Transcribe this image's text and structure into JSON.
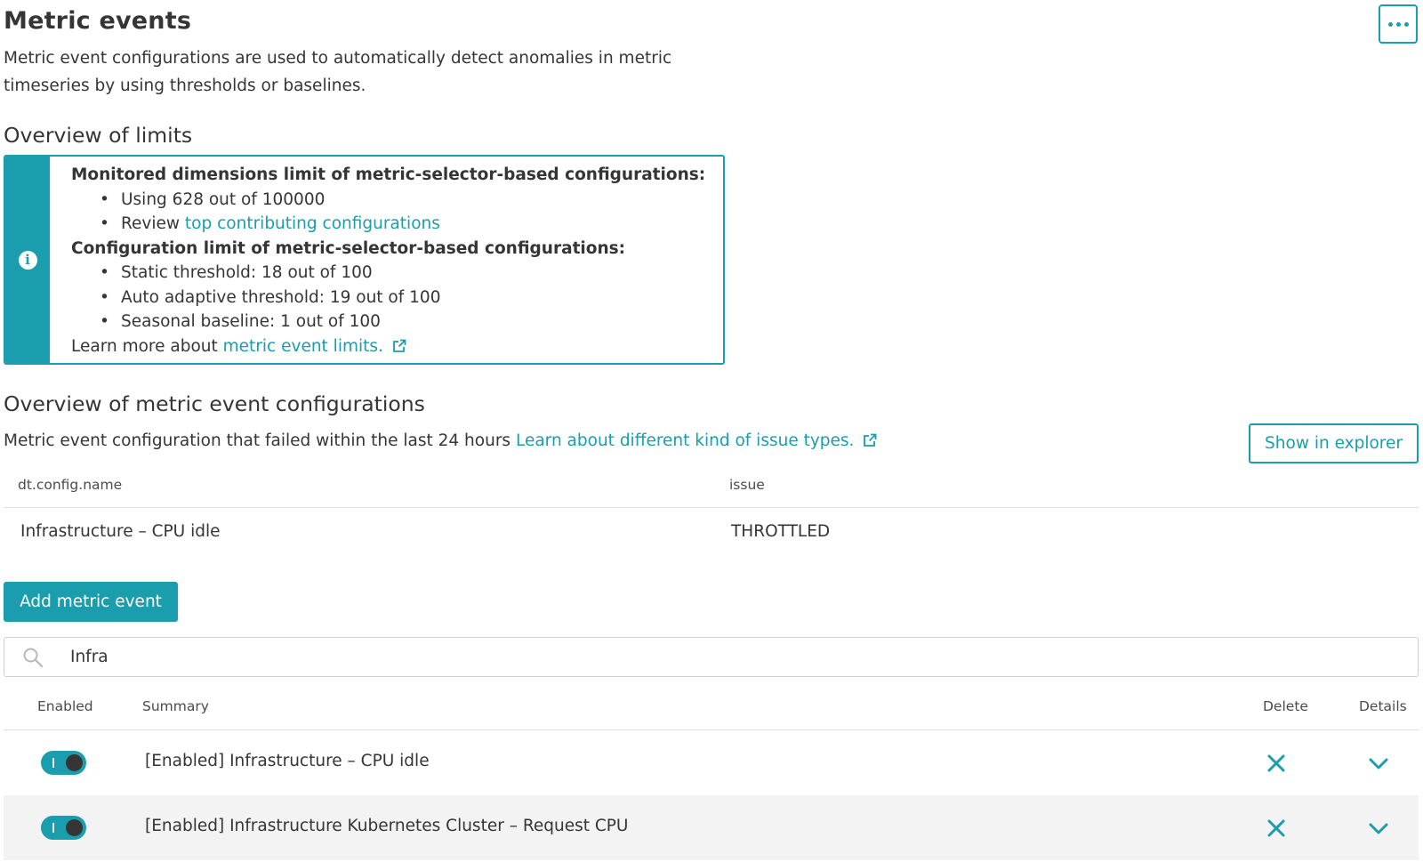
{
  "page": {
    "title": "Metric events",
    "description": "Metric event configurations are used to automatically detect anomalies in metric timeseries by using thresholds or baselines."
  },
  "limits": {
    "heading": "Overview of limits",
    "dimensions_heading": "Monitored dimensions limit of metric-selector-based configurations:",
    "usage": "Using 628 out of 100000",
    "review_prefix": "Review",
    "review_link": "top contributing configurations",
    "config_heading": "Configuration limit of metric-selector-based configurations:",
    "static_threshold": "Static threshold: 18 out of 100",
    "auto_adaptive": "Auto adaptive threshold: 19 out of 100",
    "seasonal": "Seasonal baseline: 1 out of 100",
    "learn_prefix": "Learn more about",
    "learn_link": "metric event limits."
  },
  "configs": {
    "heading": "Overview of metric event configurations",
    "failed_text": "Metric event configuration that failed within the last 24 hours",
    "learn_link": "Learn about different kind of issue types.",
    "explorer_label": "Show in explorer",
    "columns": [
      "dt.config.name",
      "issue"
    ],
    "rows": [
      {
        "name": "Infrastructure – CPU idle",
        "issue": "THROTTLED"
      }
    ]
  },
  "actions": {
    "add_label": "Add metric event"
  },
  "search": {
    "value": "Infra"
  },
  "list": {
    "columns": {
      "enabled": "Enabled",
      "summary": "Summary",
      "delete": "Delete",
      "details": "Details"
    },
    "rows": [
      {
        "summary": "[Enabled] Infrastructure – CPU idle",
        "enabled": true
      },
      {
        "summary": "[Enabled] Infrastructure Kubernetes Cluster – Request CPU",
        "enabled": true
      }
    ]
  },
  "icons": {
    "more": "more-icon",
    "info": "info-icon",
    "external": "external-link-icon",
    "search": "search-icon",
    "delete": "close-icon",
    "details": "chevron-down-icon"
  },
  "colors": {
    "accent": "#1a9dac",
    "text": "#353535",
    "row_alt": "#f3f3f3"
  }
}
